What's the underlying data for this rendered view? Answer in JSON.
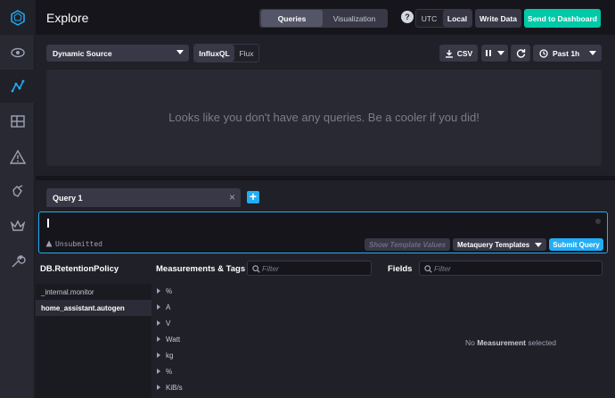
{
  "header": {
    "title": "Explore",
    "tabs": [
      {
        "label": "Queries"
      },
      {
        "label": "Visualization"
      }
    ],
    "help_label": "?",
    "timezones": [
      {
        "label": "UTC"
      },
      {
        "label": "Local"
      }
    ],
    "write_data_label": "Write Data",
    "send_to_dashboard_label": "Send to Dashboard"
  },
  "toolbar": {
    "source_label": "Dynamic Source",
    "languages": [
      {
        "label": "InfluxQL"
      },
      {
        "label": "Flux"
      }
    ],
    "csv_label": "CSV",
    "time_range_label": "Past 1h"
  },
  "graph": {
    "empty_message": "Looks like you don't have any queries. Be a cooler if you did!"
  },
  "query_tabs": [
    {
      "label": "Query 1"
    }
  ],
  "editor": {
    "status": "Unsubmitted",
    "show_template_values_label": "Show Template Values",
    "metaquery_templates_label": "Metaquery Templates",
    "submit_label": "Submit Query"
  },
  "schema": {
    "db_header": "DB.RetentionPolicy",
    "measurements_header": "Measurements & Tags",
    "fields_header": "Fields",
    "filter_placeholder": "Filter",
    "databases": [
      {
        "label": "_internal.monitor"
      },
      {
        "label": "home_assistant.autogen"
      }
    ],
    "measurements": [
      {
        "label": "%"
      },
      {
        "label": "A"
      },
      {
        "label": "V"
      },
      {
        "label": "Watt"
      },
      {
        "label": "kg"
      },
      {
        "label": "%"
      },
      {
        "label": "KiB/s"
      }
    ],
    "no_measurement_prefix": "No",
    "no_measurement_bold": "Measurement",
    "no_measurement_suffix": "selected"
  },
  "colors": {
    "accent": "#22adf6",
    "success": "#00c9a7",
    "background": "#202028"
  }
}
